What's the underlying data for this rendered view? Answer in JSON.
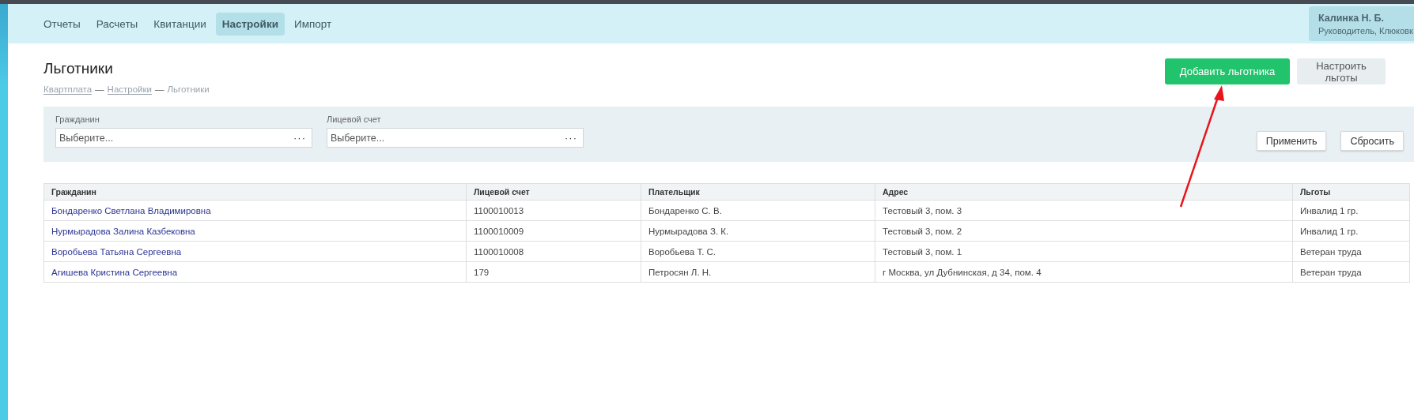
{
  "nav": {
    "tabs": [
      {
        "label": "Отчеты",
        "selected": false
      },
      {
        "label": "Расчеты",
        "selected": false
      },
      {
        "label": "Квитанции",
        "selected": false
      },
      {
        "label": "Настройки",
        "selected": true
      },
      {
        "label": "Импорт",
        "selected": false
      }
    ],
    "user": {
      "name": "Калинка Н. Б.",
      "role": "Руководитель, Клюковк"
    }
  },
  "page": {
    "title": "Льготники",
    "breadcrumbs": [
      {
        "label": "Квартплата",
        "kind": "link"
      },
      {
        "label": "Настройки",
        "kind": "link"
      },
      {
        "label": "Льготники",
        "kind": "current"
      }
    ],
    "separator": "—",
    "actions": [
      {
        "label": "Добавить льготника",
        "kind": "primary"
      },
      {
        "label": "Настроить льготы",
        "kind": "secondary"
      }
    ]
  },
  "filters": {
    "fields": [
      {
        "label": "Гражданин",
        "placeholder": "Выберите...",
        "button": "···"
      },
      {
        "label": "Лицевой счет",
        "placeholder": "Выберите...",
        "button": "···"
      }
    ],
    "buttons": [
      "Применить",
      "Сбросить"
    ]
  },
  "table": {
    "columns": [
      "Гражданин",
      "Лицевой счет",
      "Плательщик",
      "Адрес",
      "Льготы"
    ],
    "rows": [
      [
        "Бондаренко Светлана Владимировна",
        "1100010013",
        "Бондаренко С. В.",
        "Тестовый 3, пом. 3",
        "Инвалид 1 гр."
      ],
      [
        "Нурмырадова Залина Казбековна",
        "1100010009",
        "Нурмырадова З. К.",
        "Тестовый 3, пом. 2",
        "Инвалид 1 гр."
      ],
      [
        "Воробьева Татьяна Сергеевна",
        "1100010008",
        "Воробьева Т. С.",
        "Тестовый 3, пом. 1",
        "Ветеран труда"
      ],
      [
        "Агишева Кристина Сергеевна",
        "179",
        "Петросян Л. Н.",
        "г Москва, ул Дубнинская, д 34, пом. 4",
        "Ветеран труда"
      ]
    ]
  }
}
